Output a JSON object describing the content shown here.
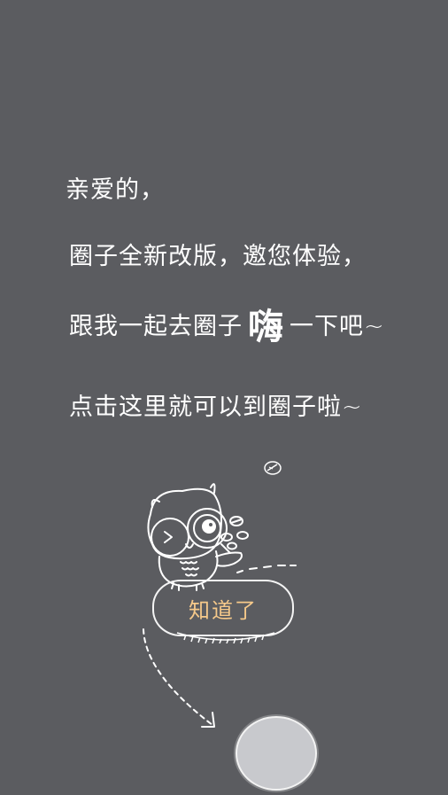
{
  "message": {
    "greeting": "亲爱的，",
    "line2": "圈子全新改版，邀您体验，",
    "line3_before": "跟我一起去圈子",
    "line3_emphasis": "嗨",
    "line3_after": "一下吧~",
    "line4": "点击这里就可以到圈子啦~"
  },
  "got_it_button": {
    "label": "知道了"
  },
  "colors": {
    "background": "#5b5c60",
    "button_text": "#f6c98a",
    "circle_fill": "#c8c9cd"
  }
}
